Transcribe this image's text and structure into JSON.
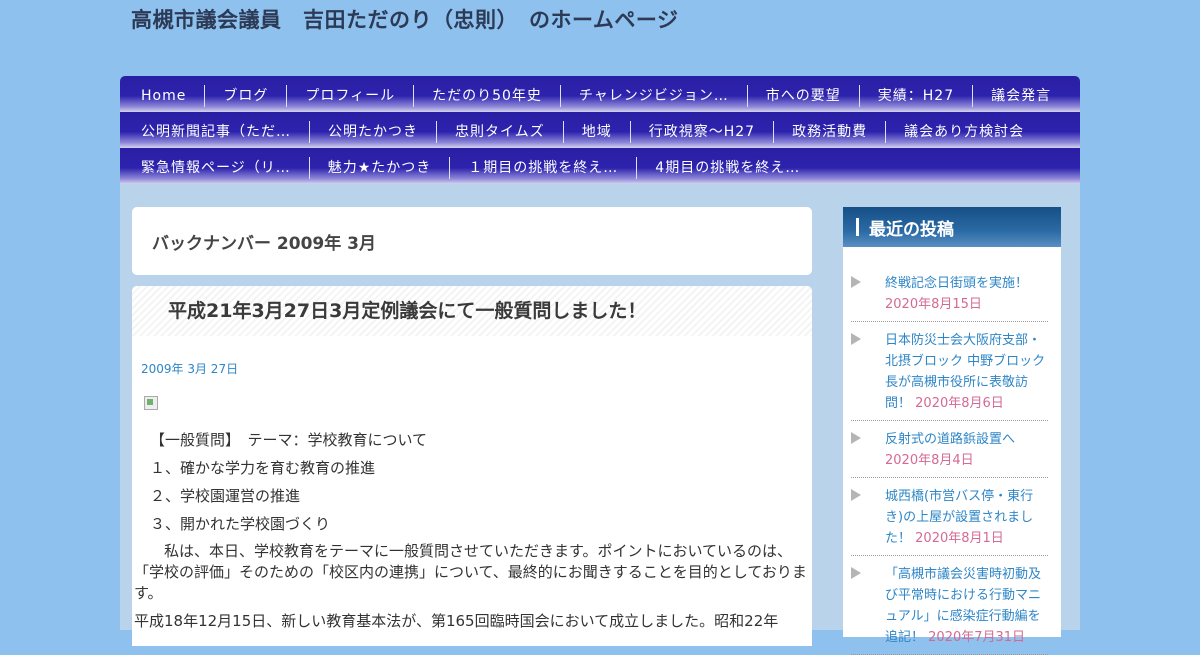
{
  "site": {
    "title": "高槻市議会議員　吉田ただのり（忠則）　のホームページ"
  },
  "nav": {
    "rows": [
      [
        "Home",
        "ブログ",
        "プロフィール",
        "ただのり50年史",
        "チャレンジビジョン…",
        "市への要望",
        "実績：H27",
        "議会発言"
      ],
      [
        "公明新聞記事（ただ…",
        "公明たかつき",
        "忠則タイムズ",
        "地域",
        "行政視察～H27",
        "政務活動費",
        "議会あり方検討会"
      ],
      [
        "緊急情報ページ（リ…",
        "魅力★たかつき",
        "１期目の挑戦を終え…",
        "4期目の挑戦を終え…"
      ]
    ]
  },
  "archive": {
    "title": "バックナンバー 2009年 3月"
  },
  "post": {
    "title": "平成21年3月27日3月定例議会にて一般質問しました！",
    "date": "2009年 3月 27日",
    "lines": [
      "【一般質問】　テーマ：学校教育について",
      "１、確かな学力を育む教育の推進",
      "２、学校園運営の推進",
      "３、開かれた学校園づくり"
    ],
    "paragraph": "　　私は、本日、学校教育をテーマに一般質問させていただきます。ポイントにおいているのは、「学校の評価」そのための「校区内の連携」について、最終的にお聞きすることを目的としております。",
    "paragraph2": "平成18年12月15日、新しい教育基本法が、第165回臨時国会において成立しました。昭和22年"
  },
  "sidebar": {
    "heading": "最近の投稿",
    "items": [
      {
        "title": "終戦記念日街頭を実施！",
        "date": "2020年8月15日"
      },
      {
        "title": "日本防災士会大阪府支部・北摂ブロック 中野ブロック長が高槻市役所に表敬訪問！",
        "date": "2020年8月6日"
      },
      {
        "title": "反射式の道路鋲設置へ",
        "date": "2020年8月4日"
      },
      {
        "title": "城西橋(市営バス停・東行き)の上屋が設置されました！",
        "date": "2020年8月1日"
      },
      {
        "title": "「高槻市議会災害時初動及び平常時における行動マニュアル」に感染症行動編を追記！",
        "date": "2020年7月31日"
      }
    ]
  }
}
